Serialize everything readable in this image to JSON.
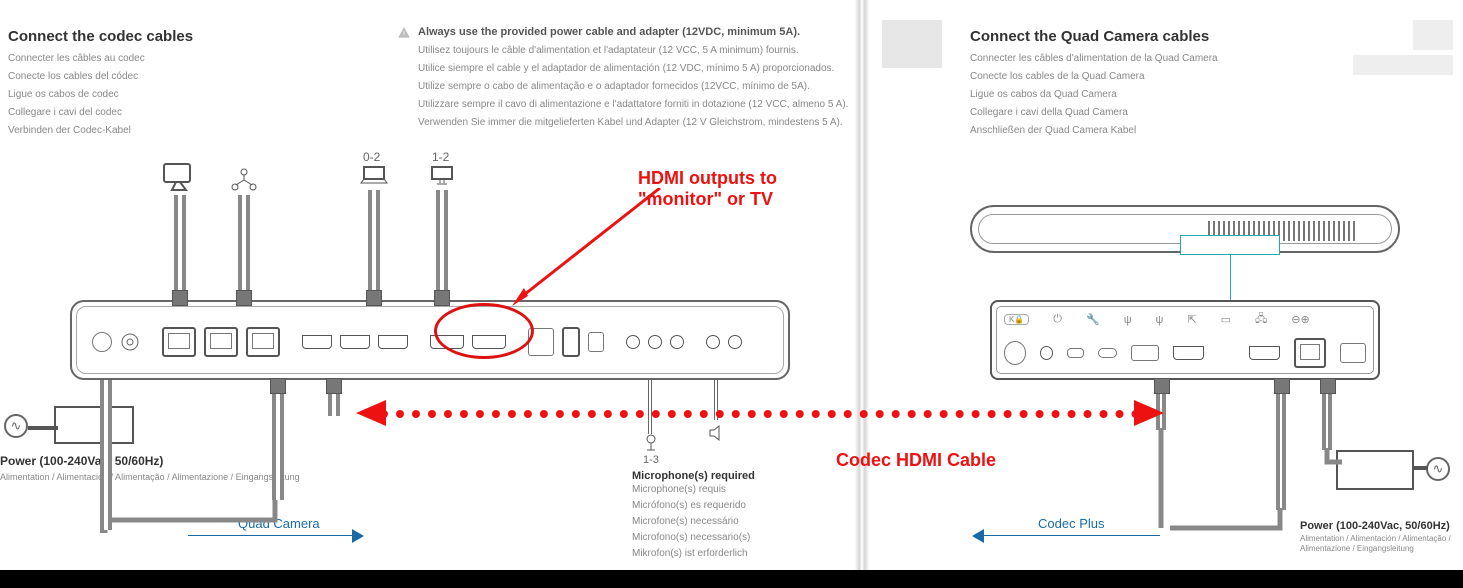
{
  "left": {
    "title": "Connect the codec cables",
    "translations": [
      "Connecter les câbles au codec",
      "Conecte los cables del códec",
      "Ligue os cabos de codec",
      "Collegare i cavi del codec",
      "Verbinden der Codec-Kabel"
    ],
    "warn_bold": "Always use the provided power cable and adapter (12VDC, minimum 5A).",
    "warn_lines": [
      "Utilisez toujours le câble d'alimentation et l'adaptateur (12 VCC, 5 A minimum) fournis.",
      "Utilice siempre el cable y el adaptador de alimentación (12 VDC, mínimo 5 A) proporcionados.",
      "Utilize sempre o cabo de alimentação e o adaptador fornecidos (12VCC, mínimo de 5A).",
      "Utilizzare sempre il cavo di alimentazione e l'adattatore forniti in dotazione (12 VCC, almeno 5 A).",
      "Verwenden Sie immer die mitgelieferten Kabel und Adapter (12 V Gleichstrom, mindestens 5 A)."
    ],
    "label_0_2": "0-2",
    "label_1_2": "1-2",
    "label_1_3": "1-3",
    "power_title": "Power (100-240Vac, 50/60Hz)",
    "power_sub": "Alimentation / Alimentación / Alimentação / Alimentazione / Eingangsleitung",
    "quad_label": "Quad Camera",
    "mic_title": "Microphone(s) required",
    "mic_lines": [
      "Microphone(s) requis",
      "Micrófono(s) es requerido",
      "Microfone(s) necessário",
      "Microfono(s) necessario(s)",
      "Mikrofon(s) ist erforderlich"
    ]
  },
  "annotations": {
    "hdmi_out": "HDMI outputs to \"monitor\" or TV",
    "codec_cable": "Codec HDMI Cable"
  },
  "right": {
    "title": "Connect the Quad Camera cables",
    "translations": [
      "Connecter les câbles d'alimentation de la Quad Camera",
      "Conecte los cables de la Quad Camera",
      "Ligue os cabos da Quad Camera",
      "Collegare i cavi della Quad Camera",
      "Anschließen der Quad Camera Kabel"
    ],
    "codec_plus": "Codec Plus",
    "power_title": "Power (100-240Vac, 50/60Hz)",
    "power_sub": "Alimentation / Alimentación / Alimentação / Alimentazione / Eingangsleitung"
  }
}
